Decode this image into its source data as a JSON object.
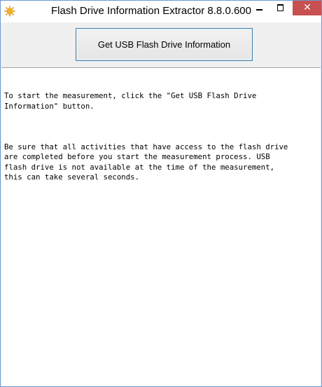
{
  "window": {
    "title": "Flash Drive Information Extractor 8.8.0.600",
    "app_icon": "sun-icon",
    "controls": {
      "minimize_icon": "minimize-icon",
      "maximize_icon": "maximize-icon",
      "close_icon": "close-icon",
      "close_label": "✕"
    }
  },
  "toolbar": {
    "main_button_label": "Get USB Flash Drive Information"
  },
  "output": {
    "paragraphs": [
      "To start the measurement, click the \"Get USB Flash Drive\nInformation\" button.",
      "Be sure that all activities that have access to the flash drive\nare completed before you start the measurement process. USB\nflash drive is not available at the time of the measurement,\nthis can take several seconds."
    ]
  },
  "colors": {
    "window_border": "#6e9ad4",
    "close_button": "#c75050",
    "button_border": "#3c7fb1",
    "app_icon": "#f5a623"
  }
}
